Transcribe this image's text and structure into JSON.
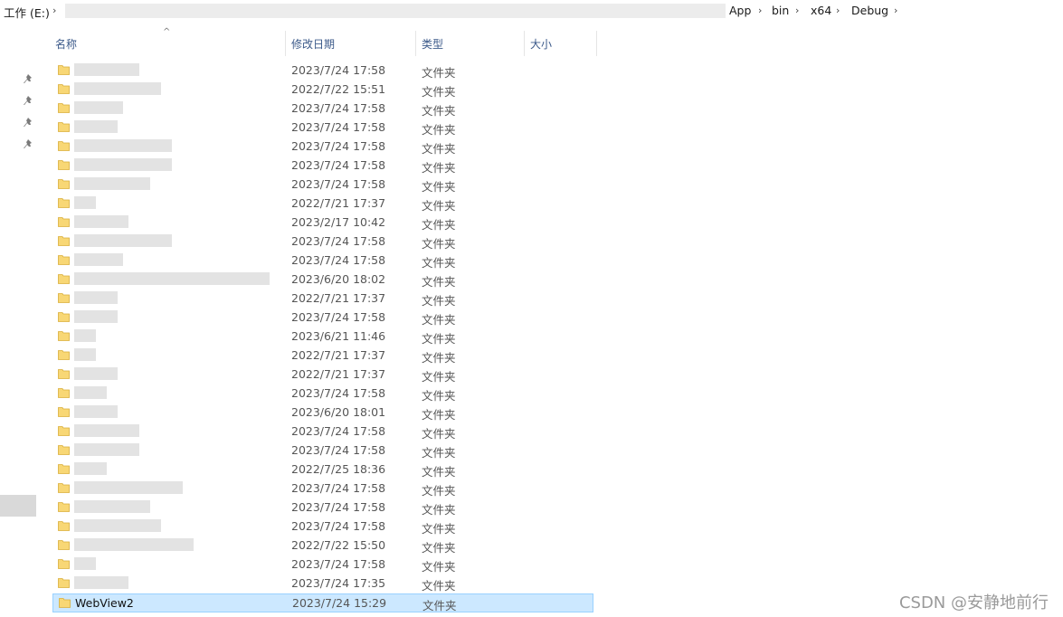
{
  "breadcrumb": {
    "drive": "工作 (E:)",
    "items": [
      "App",
      "bin",
      "x64",
      "Debug"
    ]
  },
  "columns": {
    "name": "名称",
    "date": "修改日期",
    "type": "类型",
    "size": "大小"
  },
  "rows": [
    {
      "name": "",
      "date": "2023/7/24 17:58",
      "type": "文件夹",
      "blur": 72
    },
    {
      "name": "",
      "date": "2022/7/22 15:51",
      "type": "文件夹",
      "blur": 96
    },
    {
      "name": "",
      "date": "2023/7/24 17:58",
      "type": "文件夹",
      "blur": 54
    },
    {
      "name": "",
      "date": "2023/7/24 17:58",
      "type": "文件夹",
      "blur": 48
    },
    {
      "name": "",
      "date": "2023/7/24 17:58",
      "type": "文件夹",
      "blur": 108
    },
    {
      "name": "",
      "date": "2023/7/24 17:58",
      "type": "文件夹",
      "blur": 108
    },
    {
      "name": "",
      "date": "2023/7/24 17:58",
      "type": "文件夹",
      "blur": 84
    },
    {
      "name": "",
      "date": "2022/7/21 17:37",
      "type": "文件夹",
      "blur": 24
    },
    {
      "name": "",
      "date": "2023/2/17 10:42",
      "type": "文件夹",
      "blur": 60
    },
    {
      "name": "",
      "date": "2023/7/24 17:58",
      "type": "文件夹",
      "blur": 108
    },
    {
      "name": "",
      "date": "2023/7/24 17:58",
      "type": "文件夹",
      "blur": 54
    },
    {
      "name": "",
      "date": "2023/6/20 18:02",
      "type": "文件夹",
      "blur": 216
    },
    {
      "name": "",
      "date": "2022/7/21 17:37",
      "type": "文件夹",
      "blur": 48
    },
    {
      "name": "",
      "date": "2023/7/24 17:58",
      "type": "文件夹",
      "blur": 48
    },
    {
      "name": "",
      "date": "2023/6/21 11:46",
      "type": "文件夹",
      "blur": 24
    },
    {
      "name": "",
      "date": "2022/7/21 17:37",
      "type": "文件夹",
      "blur": 24
    },
    {
      "name": "",
      "date": "2022/7/21 17:37",
      "type": "文件夹",
      "blur": 48
    },
    {
      "name": "",
      "date": "2023/7/24 17:58",
      "type": "文件夹",
      "blur": 36
    },
    {
      "name": "",
      "date": "2023/6/20 18:01",
      "type": "文件夹",
      "blur": 48
    },
    {
      "name": "",
      "date": "2023/7/24 17:58",
      "type": "文件夹",
      "blur": 72
    },
    {
      "name": "",
      "date": "2023/7/24 17:58",
      "type": "文件夹",
      "blur": 72
    },
    {
      "name": "",
      "date": "2022/7/25 18:36",
      "type": "文件夹",
      "blur": 36
    },
    {
      "name": "",
      "date": "2023/7/24 17:58",
      "type": "文件夹",
      "blur": 120
    },
    {
      "name": "",
      "date": "2023/7/24 17:58",
      "type": "文件夹",
      "blur": 84
    },
    {
      "name": "",
      "date": "2023/7/24 17:58",
      "type": "文件夹",
      "blur": 96
    },
    {
      "name": "",
      "date": "2022/7/22 15:50",
      "type": "文件夹",
      "blur": 132
    },
    {
      "name": "",
      "date": "2023/7/24 17:58",
      "type": "文件夹",
      "blur": 24
    },
    {
      "name": "",
      "date": "2023/7/24 17:35",
      "type": "文件夹",
      "blur": 60
    },
    {
      "name": "WebView2",
      "date": "2023/7/24 15:29",
      "type": "文件夹",
      "blur": 0,
      "selected": true
    }
  ],
  "watermark": "CSDN @安静地前行"
}
